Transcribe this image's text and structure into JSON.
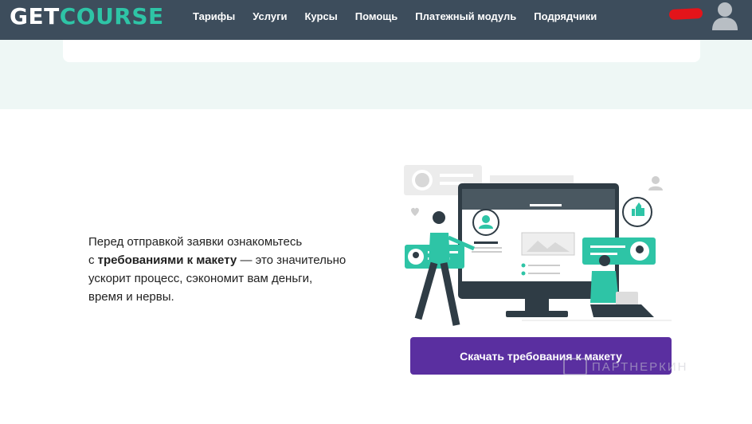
{
  "header": {
    "logo_get": "GET",
    "logo_course": "COURSE",
    "nav": [
      "Тарифы",
      "Услуги",
      "Курсы",
      "Помощь",
      "Платежный модуль",
      "Подрядчики"
    ],
    "accent_color": "#2ec4a6",
    "background_color": "#3d4d5c"
  },
  "intro": {
    "line1": "Перед отправкой заявки ознакомьтесь",
    "line2_prefix": "с ",
    "line2_bold": "требованиями к макету",
    "line2_suffix": " — это значительно",
    "line3": "ускорит процесс, сэкономит вам деньги,",
    "line4": "время и нервы."
  },
  "cta": {
    "label": "Скачать требования к макету",
    "color": "#5a2fa0"
  },
  "watermark": {
    "text": "ПАРТНЕРКИН"
  }
}
